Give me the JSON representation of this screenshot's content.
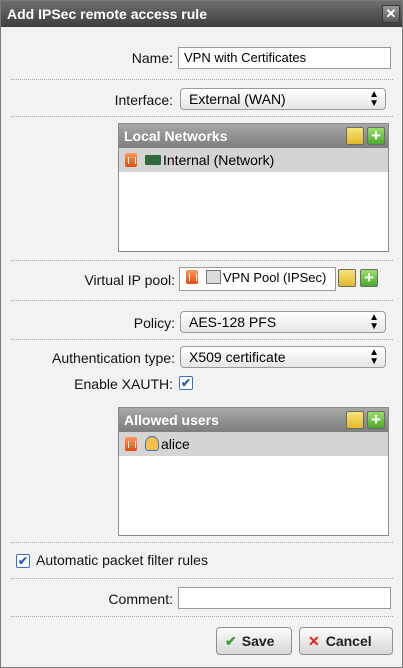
{
  "dialog": {
    "title": "Add IPSec remote access rule",
    "close_glyph": "✕"
  },
  "name": {
    "label": "Name:",
    "value": "VPN with Certificates"
  },
  "interface": {
    "label": "Interface:",
    "value": "External (WAN)"
  },
  "local_networks": {
    "header": "Local Networks",
    "items": [
      {
        "label": "Internal (Network)",
        "icon": "network-icon"
      }
    ]
  },
  "virtual_ip_pool": {
    "label": "Virtual IP pool:",
    "value": "VPN Pool (IPSec)",
    "icon": "ip-pool-icon"
  },
  "policy": {
    "label": "Policy:",
    "value": "AES-128 PFS"
  },
  "auth_type": {
    "label": "Authentication type:",
    "value": "X509 certificate"
  },
  "xauth": {
    "label": "Enable XAUTH:",
    "checked": true
  },
  "allowed_users": {
    "header": "Allowed users",
    "items": [
      {
        "label": "alice",
        "icon": "user-icon"
      }
    ]
  },
  "auto_pf": {
    "label": "Automatic packet filter rules",
    "checked": true
  },
  "comment": {
    "label": "Comment:",
    "value": ""
  },
  "buttons": {
    "save": "Save",
    "cancel": "Cancel",
    "save_glyph": "✔",
    "cancel_glyph": "✕"
  },
  "colors": {
    "title_bar": "#4e4e4e",
    "list_header": "#8f8f8f",
    "selected_row": "#d4d4d4",
    "add_green": "#4caa2b",
    "cancel_red": "#d9261c"
  }
}
